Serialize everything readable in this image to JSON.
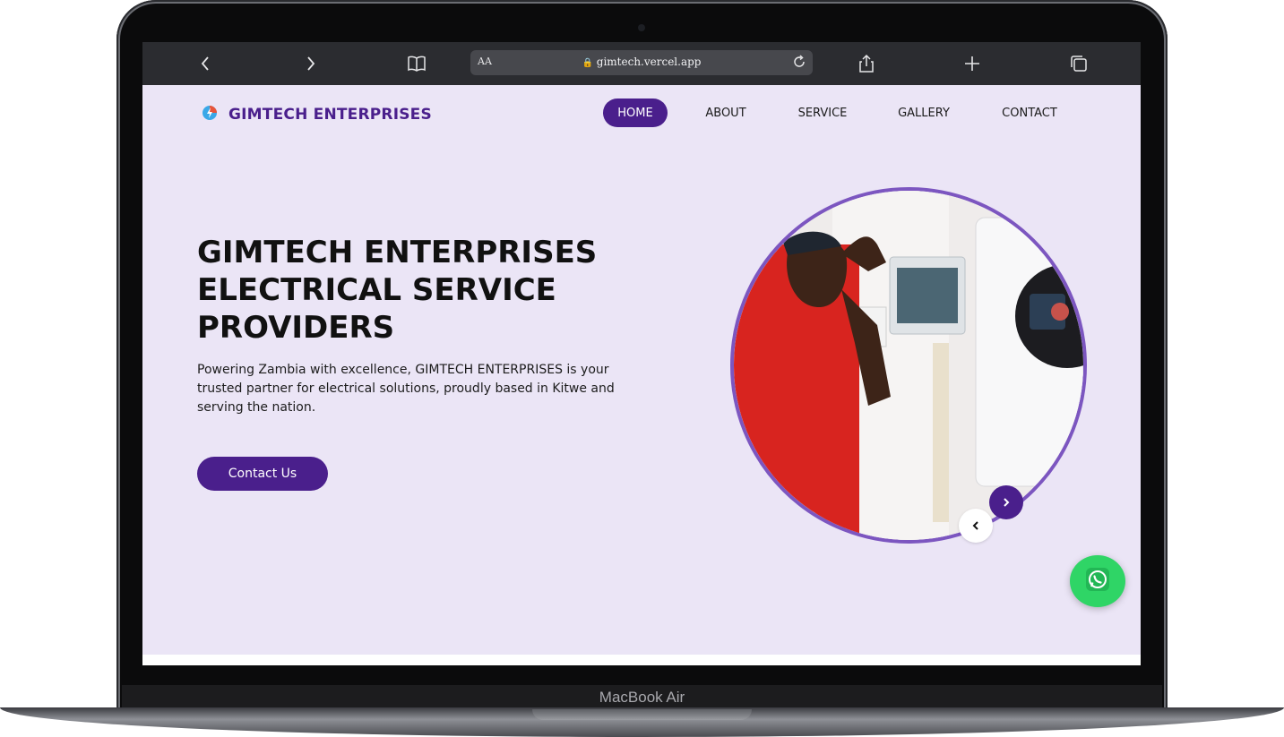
{
  "device": {
    "label": "MacBook Air"
  },
  "browser": {
    "url": "gimtech.vercel.app",
    "reader_label": "AA",
    "icons": [
      "back-icon",
      "forward-icon",
      "bookmarks-icon",
      "lock-icon",
      "reload-icon",
      "share-icon",
      "new-tab-icon",
      "tabs-icon"
    ]
  },
  "header": {
    "brand": "GIMTECH ENTERPRISES",
    "nav": [
      {
        "label": "HOME",
        "active": true
      },
      {
        "label": "ABOUT",
        "active": false
      },
      {
        "label": "SERVICE",
        "active": false
      },
      {
        "label": "GALLERY",
        "active": false
      },
      {
        "label": "CONTACT",
        "active": false
      }
    ]
  },
  "hero": {
    "title_lines": [
      "GIMTECH ENTERPRISES",
      "ELECTRICAL SERVICE",
      "PROVIDERS"
    ],
    "description": "Powering Zambia with excellence, GIMTECH ENTERPRISES is your trusted partner for electrical solutions, proudly based in Kitwe and serving the nation.",
    "cta_label": "Contact Us"
  },
  "colors": {
    "accent": "#4a1f8c",
    "page_bg": "#ebe5f6",
    "ring": "#7c56c0",
    "whatsapp": "#2fd566"
  }
}
